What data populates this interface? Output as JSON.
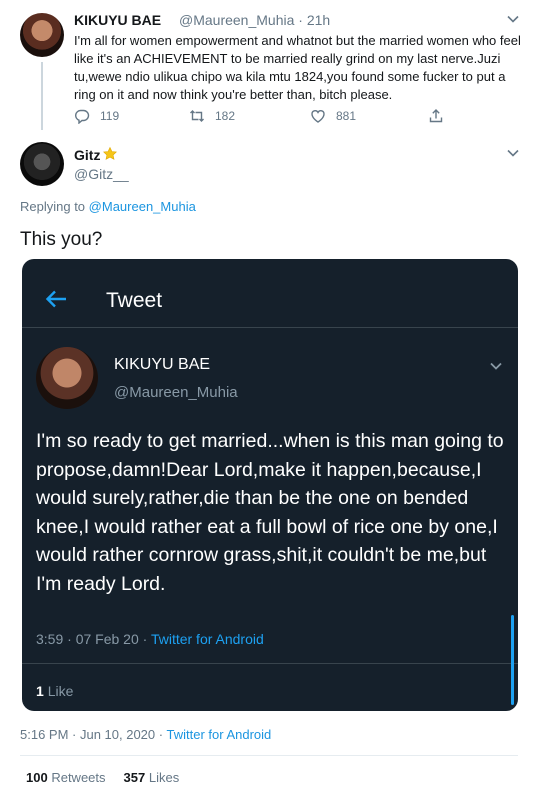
{
  "parent_tweet": {
    "name": "KIKUYU BAE",
    "handle": "@Maureen_Muhia",
    "time": "· 21h",
    "text": "I'm all for women empowerment and whatnot but the married women who feel like it's an ACHIEVEMENT to be married really grind on my last nerve.Juzi tu,wewe ndio ulikua chipo wa kila mtu 1824,you found some fucker to put a ring on it and now think you're better than, bitch please.",
    "replies": "119",
    "retweets": "182",
    "likes": "881"
  },
  "reply_tweet": {
    "name": "Gitz",
    "handle": "@Gitz__",
    "replying_prefix": "Replying to",
    "replying_to": "@Maureen_Muhia",
    "text": "This you?",
    "timestamp": "5:16 PM · Jun 10, 2020 ·",
    "source": "Twitter for Android",
    "retweet_count": "100",
    "retweet_label": "Retweets",
    "like_count": "357",
    "like_label": "Likes"
  },
  "embedded_screenshot": {
    "header_title": "Tweet",
    "name": "KIKUYU BAE",
    "handle": "@Maureen_Muhia",
    "text": "I'm so ready to get married...when is this man going to propose,damn!Dear Lord,make it happen,because,I would surely,rather,die than be the one on bended knee,I would rather eat a full bowl of rice one by one,I would rather cornrow grass,shit,it couldn't be me,but I'm ready Lord.",
    "timestamp": "3:59 · 07 Feb 20 ·",
    "source": "Twitter for Android",
    "like_count": "1",
    "like_label": "Like"
  },
  "colors": {
    "text_primary": "#14171a",
    "text_secondary": "#657786",
    "link": "#1b95e0",
    "dark_bg": "#15202b",
    "dark_secondary": "#8899a6",
    "accent": "#1da1f2"
  }
}
